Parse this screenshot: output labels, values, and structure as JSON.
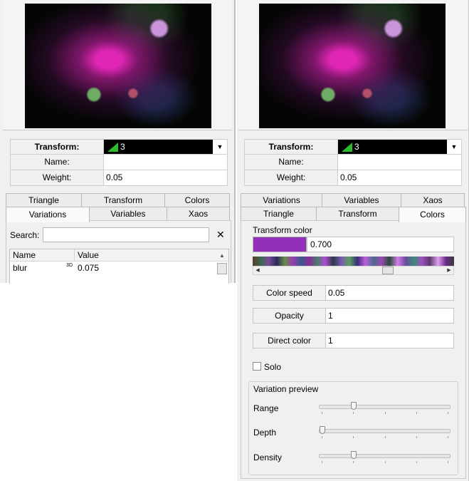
{
  "left": {
    "transform": {
      "label": "Transform:",
      "combo_value": "3"
    },
    "name": {
      "label": "Name:",
      "value": ""
    },
    "weight": {
      "label": "Weight:",
      "value": "0.05"
    },
    "tabs_top": [
      "Triangle",
      "Transform",
      "Colors"
    ],
    "tabs_bottom": [
      "Variations",
      "Variables",
      "Xaos"
    ],
    "search": {
      "label": "Search:",
      "value": ""
    },
    "table": {
      "columns": [
        "Name",
        "Value"
      ],
      "rows": [
        {
          "name": "blur",
          "badge": "3D",
          "value": "0.075"
        }
      ]
    }
  },
  "right": {
    "transform": {
      "label": "Transform:",
      "combo_value": "3"
    },
    "name": {
      "label": "Name:",
      "value": ""
    },
    "weight": {
      "label": "Weight:",
      "value": "0.05"
    },
    "tabs_top": [
      "Variations",
      "Variables",
      "Xaos"
    ],
    "tabs_bottom": [
      "Triangle",
      "Transform",
      "Colors"
    ],
    "transform_color": {
      "title": "Transform color",
      "value": "0.700",
      "swatch_color": "#9130b8",
      "scroll_fraction": 0.7
    },
    "color_speed": {
      "label": "Color speed",
      "value": "0.05"
    },
    "opacity": {
      "label": "Opacity",
      "value": "1"
    },
    "direct_color": {
      "label": "Direct color",
      "value": "1"
    },
    "solo": {
      "label": "Solo",
      "checked": false
    },
    "variation_preview": {
      "title": "Variation preview",
      "range": {
        "label": "Range",
        "level": 0.25
      },
      "depth": {
        "label": "Depth",
        "level": 0.0
      },
      "density": {
        "label": "Density",
        "level": 0.25
      }
    }
  }
}
